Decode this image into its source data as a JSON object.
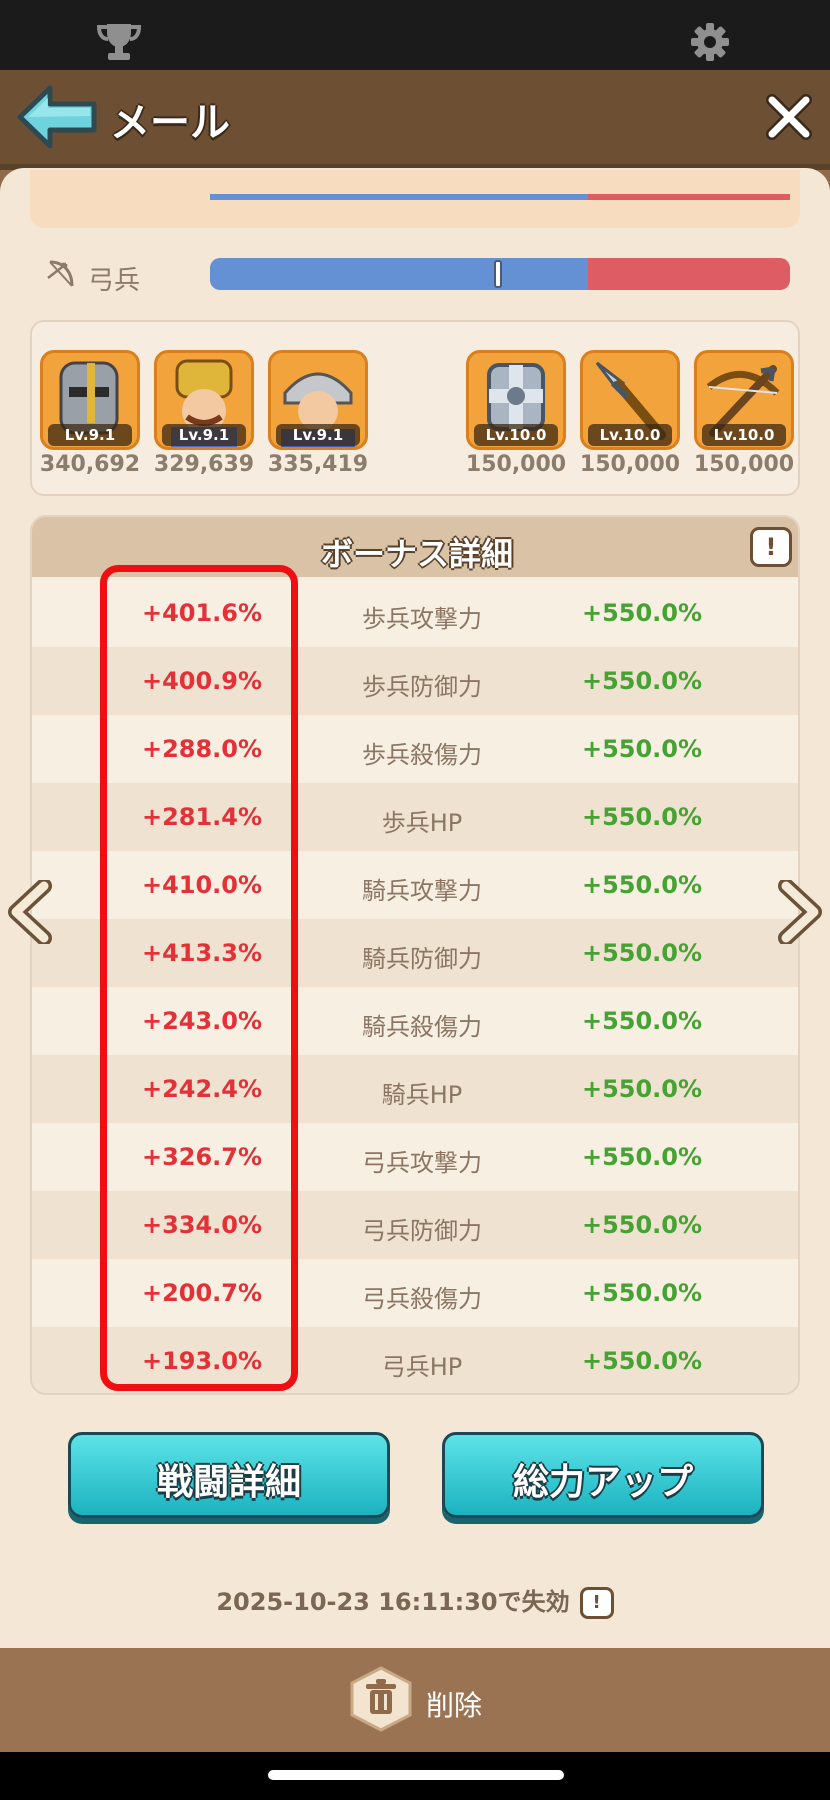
{
  "header": {
    "title": "メール"
  },
  "troop_bars": {
    "archer_label": "弓兵"
  },
  "units": {
    "left": [
      {
        "name": "knight",
        "level": "Lv.9.1",
        "power": "340,692"
      },
      {
        "name": "hero-crown",
        "level": "Lv.9.1",
        "power": "329,639"
      },
      {
        "name": "valkyrie",
        "level": "Lv.9.1",
        "power": "335,419"
      }
    ],
    "right": [
      {
        "name": "shield",
        "level": "Lv.10.0",
        "power": "150,000"
      },
      {
        "name": "spear",
        "level": "Lv.10.0",
        "power": "150,000"
      },
      {
        "name": "crossbow",
        "level": "Lv.10.0",
        "power": "150,000"
      }
    ]
  },
  "bonus": {
    "title": "ボーナス詳細",
    "info": "!",
    "rows": [
      {
        "left": "+401.6%",
        "stat": "歩兵攻撃力",
        "right": "+550.0%"
      },
      {
        "left": "+400.9%",
        "stat": "歩兵防御力",
        "right": "+550.0%"
      },
      {
        "left": "+288.0%",
        "stat": "歩兵殺傷力",
        "right": "+550.0%"
      },
      {
        "left": "+281.4%",
        "stat": "歩兵HP",
        "right": "+550.0%"
      },
      {
        "left": "+410.0%",
        "stat": "騎兵攻撃力",
        "right": "+550.0%"
      },
      {
        "left": "+413.3%",
        "stat": "騎兵防御力",
        "right": "+550.0%"
      },
      {
        "left": "+243.0%",
        "stat": "騎兵殺傷力",
        "right": "+550.0%"
      },
      {
        "left": "+242.4%",
        "stat": "騎兵HP",
        "right": "+550.0%"
      },
      {
        "left": "+326.7%",
        "stat": "弓兵攻撃力",
        "right": "+550.0%"
      },
      {
        "left": "+334.0%",
        "stat": "弓兵防御力",
        "right": "+550.0%"
      },
      {
        "left": "+200.7%",
        "stat": "弓兵殺傷力",
        "right": "+550.0%"
      },
      {
        "left": "+193.0%",
        "stat": "弓兵HP",
        "right": "+550.0%"
      }
    ]
  },
  "buttons": {
    "battle_details": "戦闘詳細",
    "power_up": "総力アップ"
  },
  "expiry": {
    "text": "2025-10-23 16:11:30で失効",
    "info": "!"
  },
  "footer": {
    "delete_label": "削除"
  },
  "colors": {
    "bonus_left": "#e23238",
    "bonus_right": "#47a234",
    "highlight": "#ef0f12",
    "button": "#27c0cc"
  }
}
